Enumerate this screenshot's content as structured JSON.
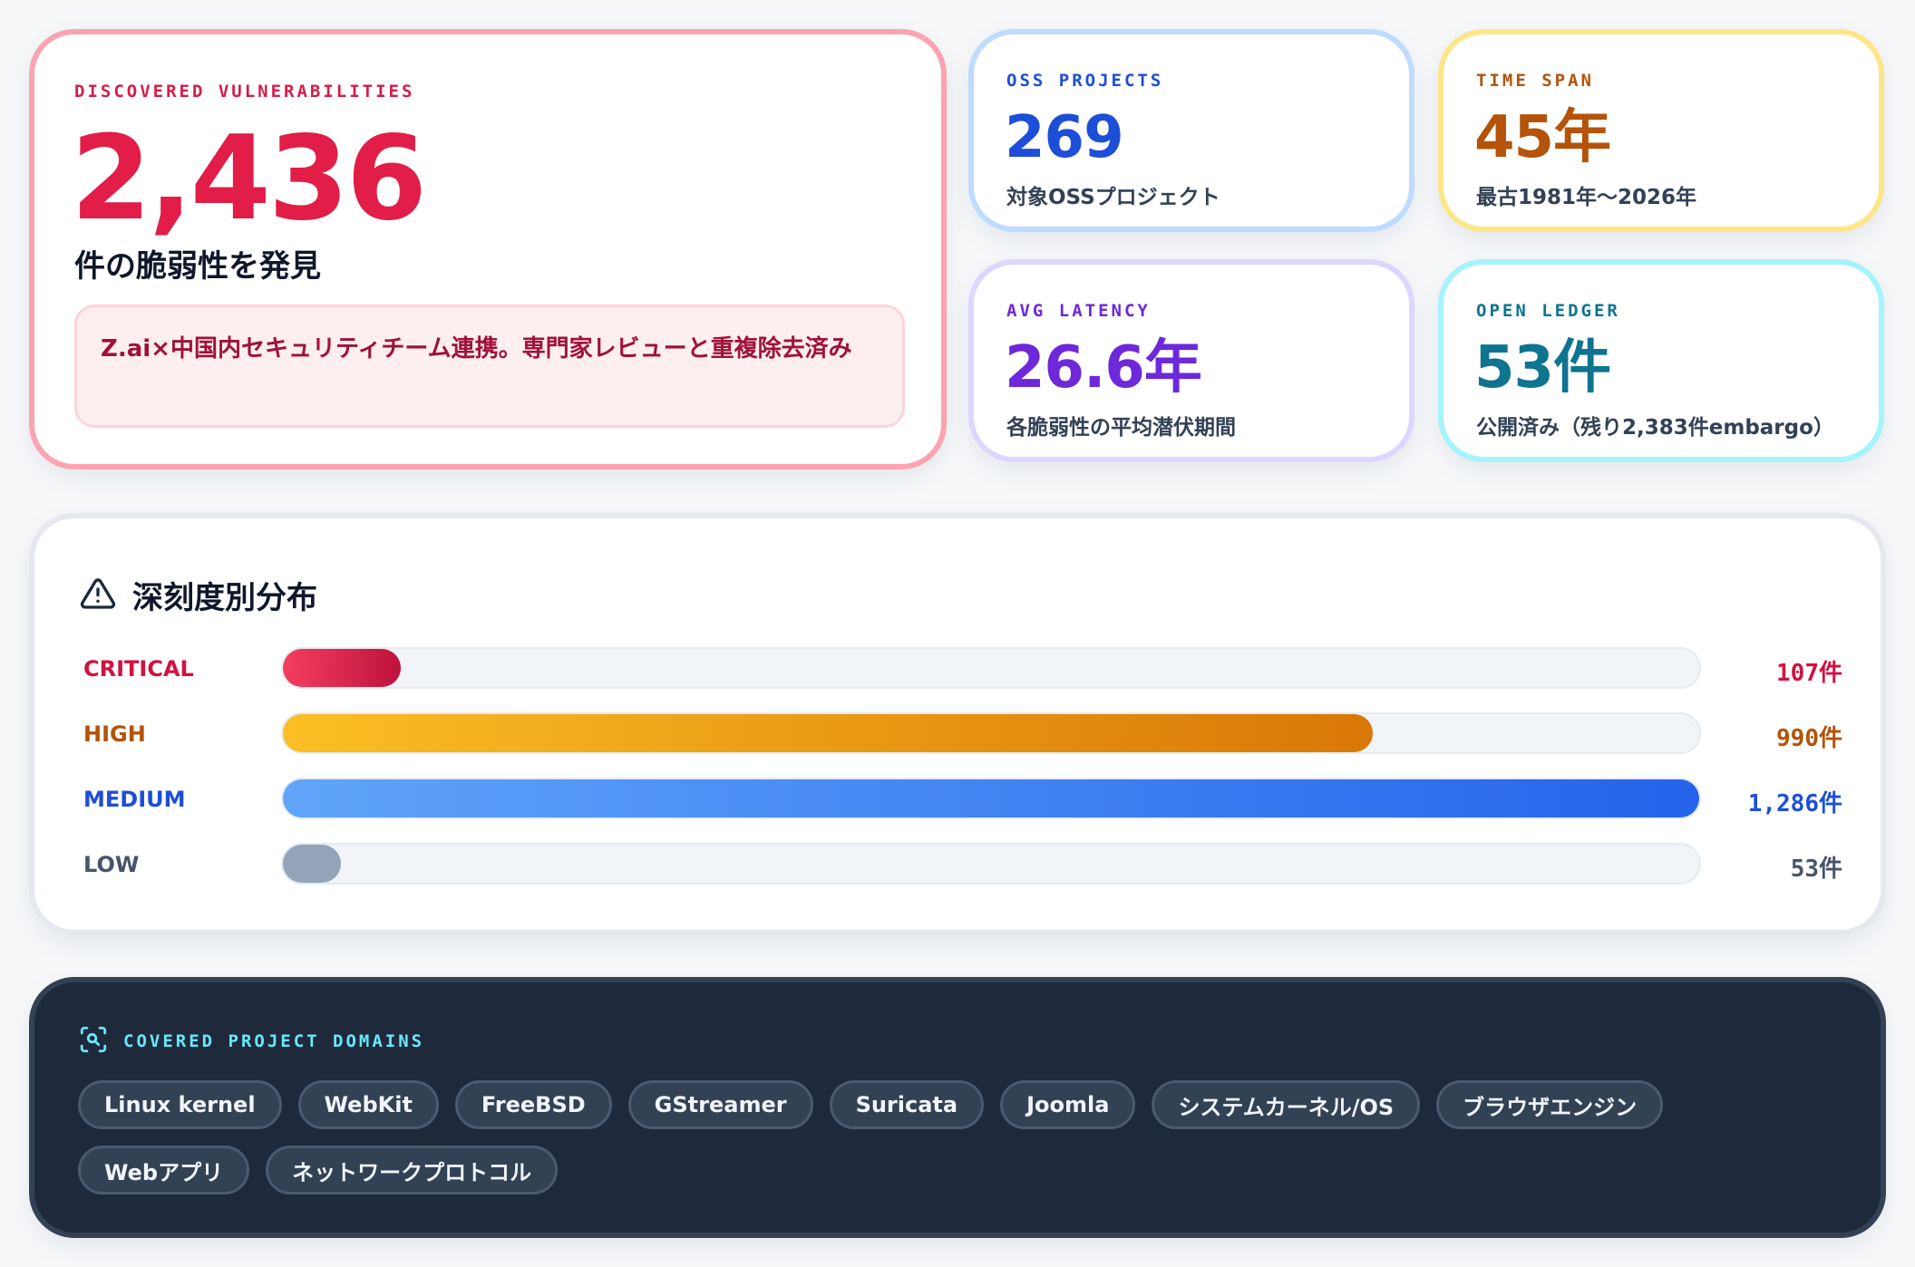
{
  "main": {
    "label": "DISCOVERED VULNERABILITIES",
    "number": "2,436",
    "caption": "件の脆弱性を発見",
    "note": "Z.ai×中国内セキュリティチーム連携。専門家レビューと重複除去済み"
  },
  "stats": {
    "oss": {
      "label": "OSS PROJECTS",
      "value": "269",
      "sub": "対象OSSプロジェクト"
    },
    "time": {
      "label": "TIME SPAN",
      "value": "45年",
      "sub": "最古1981年〜2026年"
    },
    "latency": {
      "label": "AVG LATENCY",
      "value": "26.6年",
      "sub": "各脆弱性の平均潜伏期間"
    },
    "ledger": {
      "label": "OPEN LEDGER",
      "value": "53件",
      "sub": "公開済み（残り2,383件embargo）"
    }
  },
  "severity": {
    "title": "深刻度別分布",
    "icon": "warning-triangle-icon",
    "max": 1286,
    "rows": [
      {
        "label": "CRITICAL",
        "value": 107,
        "count": "107件",
        "color": "#d1123f",
        "grad": [
          "#f43f5e",
          "#be123c"
        ]
      },
      {
        "label": "HIGH",
        "value": 990,
        "count": "990件",
        "color": "#b45309",
        "grad": [
          "#fbbf24",
          "#d97706"
        ]
      },
      {
        "label": "MEDIUM",
        "value": 1286,
        "count": "1,286件",
        "color": "#1d4ed8",
        "grad": [
          "#60a5fa",
          "#2563eb"
        ]
      },
      {
        "label": "LOW",
        "value": 53,
        "count": "53件",
        "color": "#475569",
        "grad": [
          "#94a3b8",
          "#94a3b8"
        ]
      }
    ]
  },
  "domains": {
    "label": "COVERED PROJECT DOMAINS",
    "icon": "scan-search-icon",
    "chips": [
      "Linux kernel",
      "WebKit",
      "FreeBSD",
      "GStreamer",
      "Suricata",
      "Joomla",
      "システムカーネル/OS",
      "ブラウザエンジン",
      "Webアプリ",
      "ネットワークプロトコル"
    ]
  }
}
